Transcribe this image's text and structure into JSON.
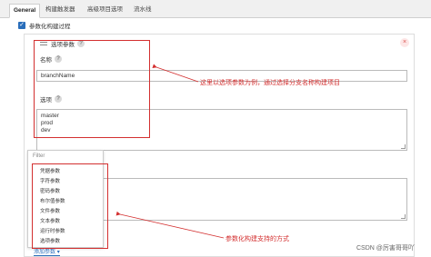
{
  "tabs": [
    {
      "label": "General"
    },
    {
      "label": "构建触发器"
    },
    {
      "label": "高级项目选项"
    },
    {
      "label": "流水线"
    }
  ],
  "checkbox": {
    "label": "参数化构建过程",
    "checked": true
  },
  "param": {
    "title": "选项参数",
    "help": "?",
    "close": "×",
    "name_label": "名称",
    "name_value": "branchName",
    "choices_label": "选项",
    "choices_value": "master\nprod\ndev"
  },
  "dropdown": {
    "filter_placeholder": "Filter",
    "items": [
      "凭据参数",
      "字符参数",
      "密码参数",
      "布尔值参数",
      "文件参数",
      "文本参数",
      "运行时参数",
      "选项参数"
    ]
  },
  "add_button": {
    "label": "添加参数",
    "arrow": "▾"
  },
  "annotations": {
    "top": "这里以选项参数为例，通过选择分支名称构建项目",
    "bottom": "参数化构建支持的方式",
    "color": "#d32f2f"
  },
  "watermark": "CSDN @厉害哥哥吖"
}
